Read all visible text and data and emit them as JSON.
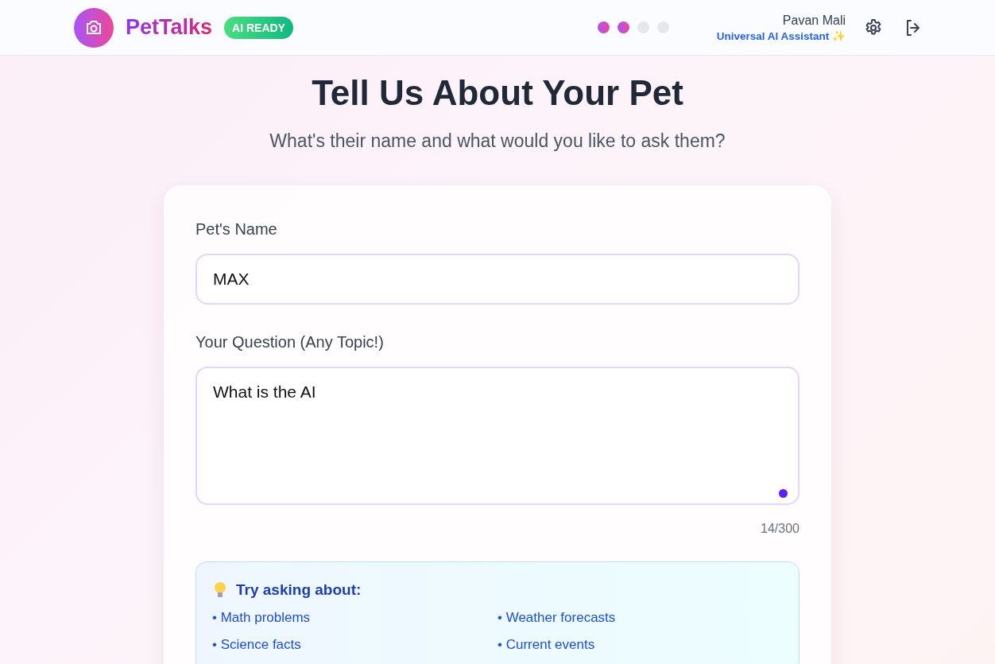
{
  "header": {
    "brand": "PetTalks",
    "badge": "AI READY",
    "steps": [
      {
        "done": true
      },
      {
        "done": true
      },
      {
        "done": false
      },
      {
        "done": false
      }
    ],
    "user": {
      "name": "Pavan Mali",
      "role": "Universal AI Assistant ✨"
    }
  },
  "title": "Tell Us About Your Pet",
  "subtitle": "What's their name and what would you like to ask them?",
  "form": {
    "name_label": "Pet's Name",
    "name_value": "MAX",
    "question_label": "Your Question (Any Topic!)",
    "question_value": "What is the AI",
    "counter": "14/300"
  },
  "tips": {
    "title": "Try asking about:",
    "items": [
      "• Math problems",
      "• Weather forecasts",
      "• Science facts",
      "• Current events"
    ]
  }
}
